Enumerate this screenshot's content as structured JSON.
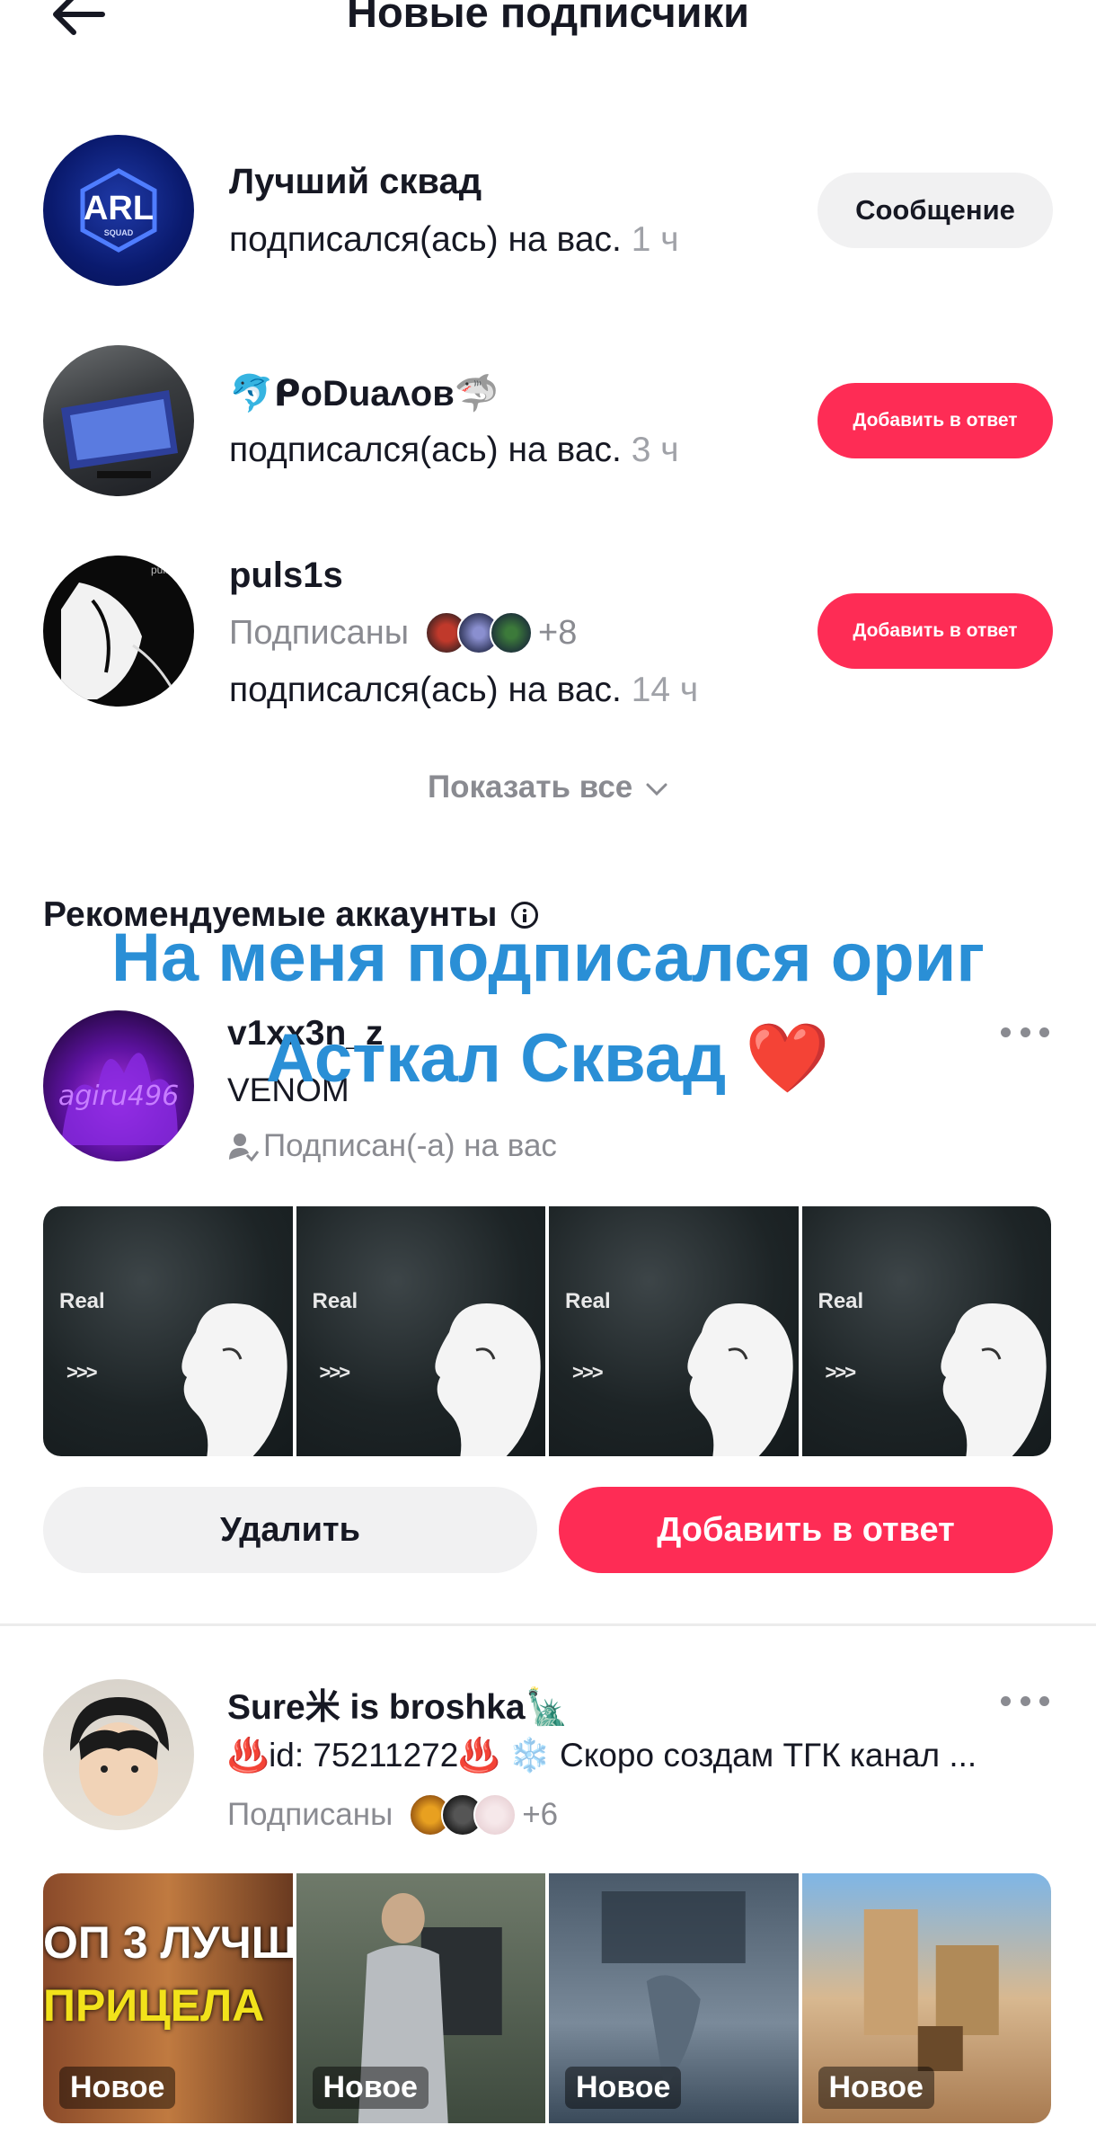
{
  "header": {
    "title": "Новые подписчики",
    "back_icon": "arrow-left-icon"
  },
  "new_followers": [
    {
      "name": "Лучший сквад",
      "action_text": "подписался(ась) на вас.",
      "time": "1 ч",
      "button_label": "Сообщение",
      "avatar_text": "ARL",
      "avatar_subtext": "SQUAD"
    },
    {
      "name": "🐬ᑭoDuaʌoв🦈",
      "action_text": "подписался(ась) на вас.",
      "time": "3 ч",
      "button_label": "Добавить в ответ"
    },
    {
      "name": "puls1s",
      "followed_by_label": "Подписаны",
      "followed_by_extra": "+8",
      "action_text": "подписался(ась) на вас.",
      "time": "14 ч",
      "button_label": "Добавить в ответ",
      "avatar_text": "puls1s"
    }
  ],
  "show_all_label": "Показать все",
  "recommended": {
    "section_title": "Рекомендуемые аккаунты",
    "overlay_line1": "На меня подписался ориг",
    "overlay_line2": "Асткал Сквад ❤️",
    "accounts": [
      {
        "username": "v1xx3n_z",
        "bio": "VENOM",
        "meta": "Подписан(-а) на вас",
        "avatar_text": "agiru496",
        "thumb_labels": [
          "Real",
          "Real",
          "Real",
          "Real"
        ],
        "thumb_arrows": ">>>",
        "delete_label": "Удалить",
        "add_label": "Добавить в ответ"
      },
      {
        "username": "Sure米 is broshka🗽",
        "bio": "♨️id: 75211272♨️ ❄️ Скоро создам ТГК канал ...",
        "followed_by_label": "Подписаны",
        "followed_by_extra": "+6",
        "thumb_tags": [
          "Новое",
          "Новое",
          "Новое",
          "Новое"
        ],
        "thumb1_text_a": "ОП 3 ЛУЧШ",
        "thumb1_text_b": "ПРИЦЕЛА"
      }
    ]
  },
  "colors": {
    "accent_red": "#fe2c55",
    "overlay_blue": "#2a8fd6",
    "muted_grey": "#8a8b91"
  }
}
